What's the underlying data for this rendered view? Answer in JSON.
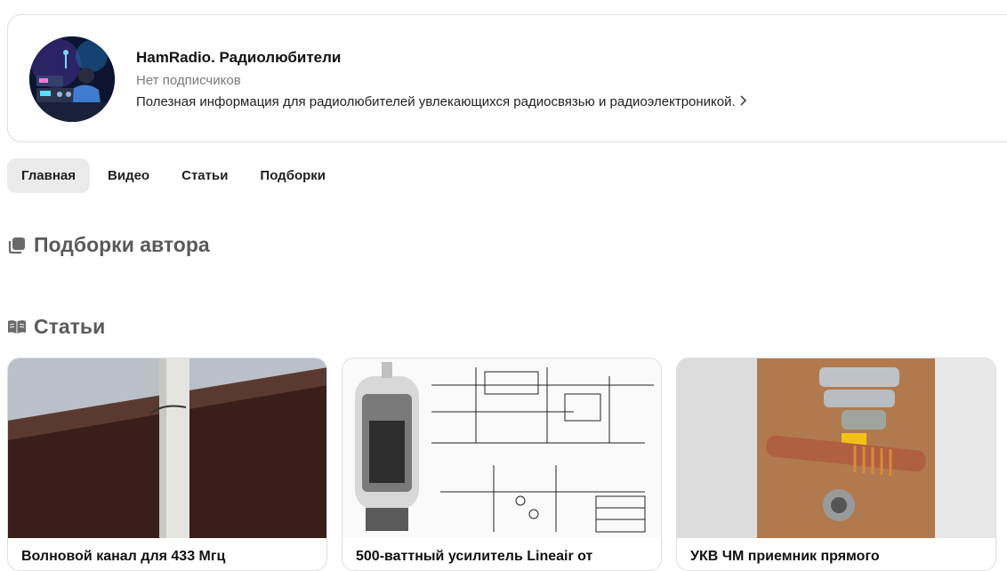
{
  "channel": {
    "name": "HamRadio. Радиолюбители",
    "subscribers": "Нет подписчиков",
    "description": "Полезная информация для радиолюбителей увлекающихся радиосвязью и радиоэлектроникой.",
    "more_icon": "chevron-right-icon"
  },
  "tabs": [
    {
      "label": "Главная",
      "active": true
    },
    {
      "label": "Видео",
      "active": false
    },
    {
      "label": "Статьи",
      "active": false
    },
    {
      "label": "Подборки",
      "active": false
    }
  ],
  "sections": {
    "collections": {
      "title": "Подборки автора",
      "icon": "collections-icon"
    },
    "articles": {
      "title": "Статьи",
      "icon": "book-icon"
    }
  },
  "articles": [
    {
      "title": "Волновой канал для 433 Мгц"
    },
    {
      "title": "500-ваттный усилитель Lineair от"
    },
    {
      "title": "УКВ ЧМ приемник прямого"
    }
  ],
  "colors": {
    "accent_bg": "#ebebeb",
    "muted_text": "#7a7a7a",
    "section_title": "#5a5a5a"
  }
}
